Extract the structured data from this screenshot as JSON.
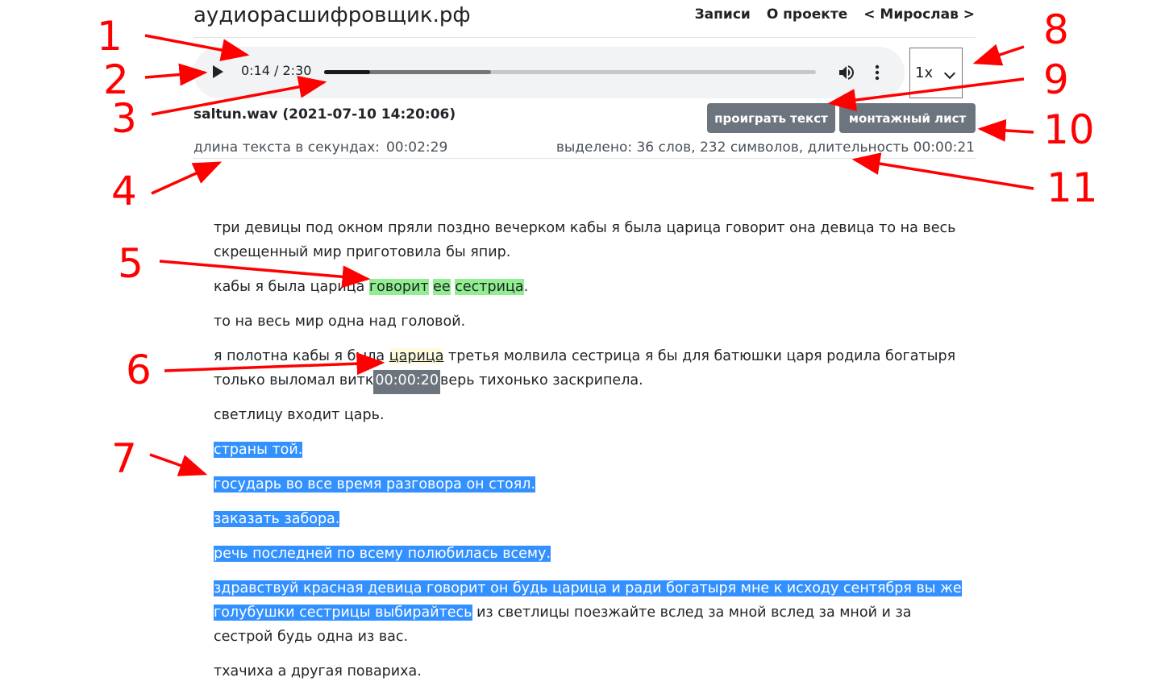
{
  "header": {
    "site_title": "аудиорасшифровщик.рф",
    "nav": [
      "Записи",
      "О проекте",
      "< Мирослав >"
    ]
  },
  "player": {
    "time": "0:14 / 2:30",
    "progress_fraction": 0.093,
    "buffered_fraction": 0.34,
    "speed": "1x"
  },
  "record": {
    "file_title": "saltun.wav (2021-07-10 14:20:06)",
    "play_text_button": "проиграть текст",
    "montage_button": "монтажный лист",
    "length_label": "длина текста в секундах:",
    "length_value": "00:02:29",
    "selection_info": "выделено: 36 слов, 232 символов, длительность 00:00:21"
  },
  "transcript": {
    "p1": "три девицы под окном пряли поздно вечерком кабы я была царица говорит она девица то на весь скрещенный мир приготовила бы япир.",
    "p2": {
      "a": "кабы я была царица ",
      "w1": "говорит",
      "w2": "ее",
      "w3": "сестрица",
      "end": "."
    },
    "p3": "то на весь мир одна над головой.",
    "p4": {
      "a": "я полотна кабы я была ",
      "cur": "царица",
      "b": " третья молвила сестрица я бы для батюшки царя родила богатыря только выломал витк",
      "tooltip": "00:00:20",
      "c": "верь тихонько заскрипела."
    },
    "p5": "светлицу входит царь.",
    "s1": "страны той.",
    "s2": "государь во все время разговора он стоял.",
    "s3": "заказать забора.",
    "s4": "речь последней по всему полюбилась всему.",
    "p10": {
      "sel": "здравствуй красная девица говорит он будь царица и ради богатыря мне к исходу сентября вы же голубушки сестрицы выбирайтесь",
      "rest": " из светлицы поезжайте вслед за мной вслед за мной и за сестрой будь одна из вас."
    },
    "p11": "тхачиха а другая повариха."
  },
  "annotations": [
    "1",
    "2",
    "3",
    "4",
    "5",
    "6",
    "7",
    "8",
    "9",
    "10",
    "11"
  ],
  "colors": {
    "annotation": "#ff0000",
    "word_highlight": "#90ee90",
    "selection": "#3390ff",
    "button": "#6c757d"
  }
}
